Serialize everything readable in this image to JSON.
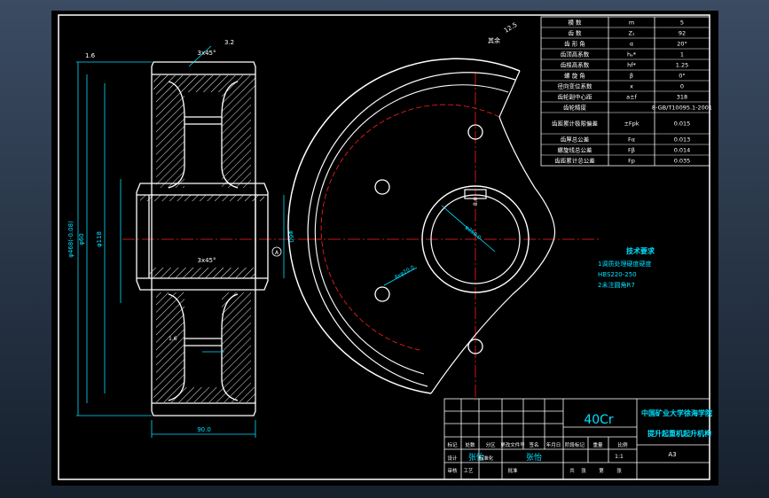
{
  "params_table": [
    {
      "label": "模 数",
      "symbol": "m",
      "value": "5"
    },
    {
      "label": "齿 数",
      "symbol": "Z₁",
      "value": "92"
    },
    {
      "label": "齿 形 角",
      "symbol": "α",
      "value": "20°"
    },
    {
      "label": "齿顶高系数",
      "symbol": "hₐ*",
      "value": "1"
    },
    {
      "label": "齿根高系数",
      "symbol": "hf*",
      "value": "1.25"
    },
    {
      "label": "螺 旋 角",
      "symbol": "β",
      "value": "0°"
    },
    {
      "label": "径向变位系数",
      "symbol": "x",
      "value": "0"
    },
    {
      "label": "齿轮副中心距",
      "symbol": "a±f",
      "value": "318"
    },
    {
      "label": "齿轮精度",
      "symbol": "",
      "value": "8-GB/T10095.1-2001"
    },
    {
      "label": "齿距累计极限偏差",
      "symbol": "±Fpk",
      "value": "0.015"
    },
    {
      "label": "齿厚总公差",
      "symbol": "Fα",
      "value": "0.013"
    },
    {
      "label": "螺旋线总公差",
      "symbol": "Fβ",
      "value": "0.014"
    },
    {
      "label": "齿距累计总公差",
      "symbol": "Fp",
      "value": "0.035"
    }
  ],
  "tech_requirements": {
    "title": "技术要求",
    "lines": [
      "1调质处理硬度硬度",
      "HBS220-250",
      "2未注圆角R7"
    ]
  },
  "title_block": {
    "material": "40Cr",
    "school": "中国矿业大学徐海学院",
    "drawing_title": "提升起重机起升机构",
    "sheet_size": "A3",
    "scale": "1:1",
    "designer": "张怡",
    "checker": "张怡",
    "labels": [
      "标记",
      "处数",
      "分区",
      "更改文件号",
      "签名",
      "年月日",
      "阶段标记",
      "重量",
      "比例",
      "设计",
      "标准化",
      "审核",
      "工艺",
      "批准",
      "共",
      "张",
      "第",
      "张"
    ]
  },
  "annotations": {
    "chamfer_top": "3x45°",
    "chamfer_mid": "3x45°",
    "roughness_top": "3.2",
    "roughness_left": "1.6",
    "roughness_12_5": "12.5",
    "roughness_other": "其余",
    "r_a": "1.6",
    "dims_left": [
      "φ468(-0.08)",
      "φ60",
      "φ118"
    ],
    "dim_right": "φ60",
    "dim_bottom": "90.0",
    "dim_hole": "4xφ20.0",
    "dim_circle": "φ250.0",
    "dim_key": "8.0",
    "dim_hub": "18.0",
    "section_mark": "A"
  }
}
